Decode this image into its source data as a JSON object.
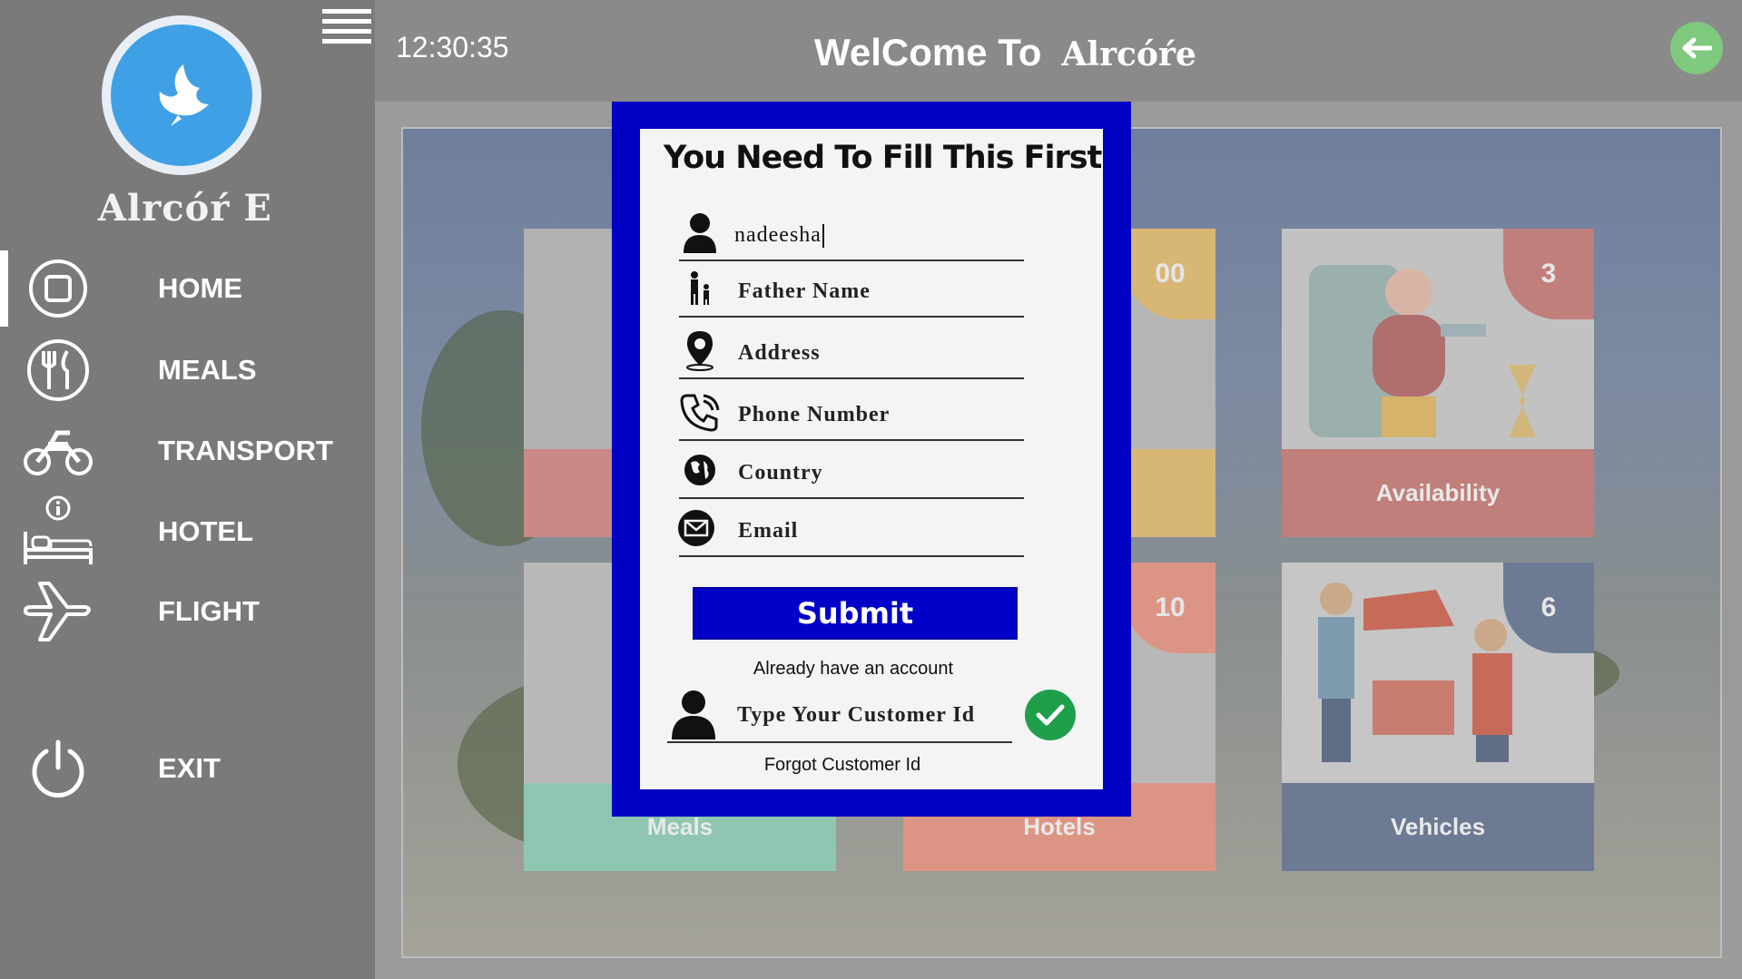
{
  "header": {
    "clock": "12:30:35",
    "welcome_prefix": "WelCome To",
    "welcome_brand": "Alrcóŕe"
  },
  "sidebar": {
    "brand": "Alrcóŕ E",
    "items": [
      {
        "label": "HOME",
        "icon": "home-circle-icon"
      },
      {
        "label": "MEALS",
        "icon": "fork-knife-icon"
      },
      {
        "label": "TRANSPORT",
        "icon": "motorbike-icon"
      },
      {
        "label": "HOTEL",
        "icon": "bed-icon"
      },
      {
        "label": "FLIGHT",
        "icon": "airplane-icon"
      }
    ],
    "exit": {
      "label": "EXIT",
      "icon": "power-icon"
    }
  },
  "cards": [
    {
      "label": "Meals",
      "badge": "",
      "color": "#8fd1b9"
    },
    {
      "label": "Hotels",
      "badge": "10",
      "color": "#f0a08d"
    },
    {
      "label": "Availability",
      "badge": "3",
      "color": "#c97a75"
    },
    {
      "label": "Vehicles",
      "badge": "6",
      "color": "#6a7a96"
    },
    {
      "label": "",
      "badge": "00",
      "color": "#e9c46a"
    }
  ],
  "modal": {
    "title": "You Need To Fill This First",
    "fields": [
      {
        "name": "username",
        "value": "nadeesha",
        "icon": "user-icon"
      },
      {
        "name": "father-name",
        "placeholder": "Father Name",
        "icon": "father-child-icon"
      },
      {
        "name": "address",
        "placeholder": "Address",
        "icon": "location-pin-icon"
      },
      {
        "name": "phone",
        "placeholder": "Phone Number",
        "icon": "phone-icon"
      },
      {
        "name": "country",
        "placeholder": "Country",
        "icon": "globe-icon"
      },
      {
        "name": "email",
        "placeholder": "Email",
        "icon": "envelope-icon"
      }
    ],
    "submit_label": "Submit",
    "already_text": "Already have an account",
    "customer_id_placeholder": "Type Your Customer Id",
    "forgot_text": "Forgot Customer Id"
  },
  "colors": {
    "modal_frame": "#0000c2",
    "submit": "#0000c8",
    "confirm": "#1f9f4a",
    "back_button": "#7ec97e",
    "avatar": "#3fa0e6"
  }
}
